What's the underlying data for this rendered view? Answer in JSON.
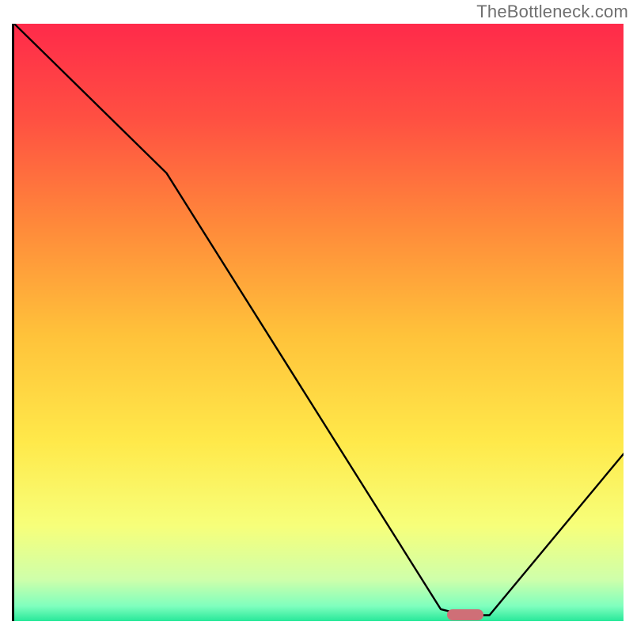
{
  "watermark": "TheBottleneck.com",
  "chart_data": {
    "type": "line",
    "title": "",
    "xlabel": "",
    "ylabel": "",
    "xlim": [
      0,
      100
    ],
    "ylim": [
      0,
      100
    ],
    "curve": {
      "name": "bottleneck-curve",
      "x": [
        0,
        25,
        70,
        74,
        78,
        100
      ],
      "y": [
        100,
        75,
        2,
        1,
        1,
        28
      ]
    },
    "marker": {
      "x": 74,
      "y": 1,
      "color": "#cf6f77",
      "shape": "pill"
    },
    "background_gradient": {
      "stops": [
        {
          "pos": 0.0,
          "color": "#ff2a4a"
        },
        {
          "pos": 0.16,
          "color": "#ff5042"
        },
        {
          "pos": 0.34,
          "color": "#ff8a3a"
        },
        {
          "pos": 0.52,
          "color": "#ffc23a"
        },
        {
          "pos": 0.7,
          "color": "#ffe94a"
        },
        {
          "pos": 0.84,
          "color": "#f7ff7a"
        },
        {
          "pos": 0.93,
          "color": "#cfffaa"
        },
        {
          "pos": 0.975,
          "color": "#7fffbe"
        },
        {
          "pos": 1.0,
          "color": "#28e89a"
        }
      ]
    }
  }
}
